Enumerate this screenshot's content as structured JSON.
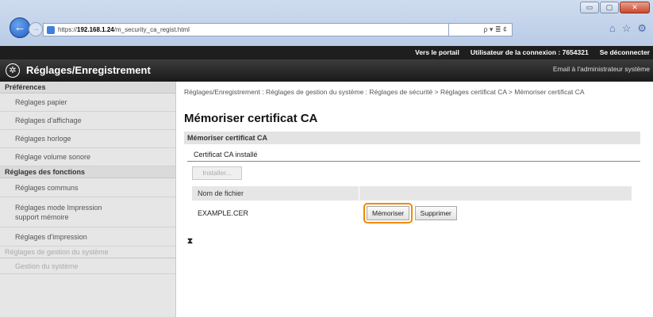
{
  "browser": {
    "url_prefix": "https://",
    "url_host": "192.168.1.24",
    "url_path": "/m_security_ca_regist.html",
    "addr_tools": "ρ ▾ ≣ ¢",
    "back_glyph": "←",
    "forward_glyph": "→",
    "window_controls": [
      "▭",
      "▢",
      "✕"
    ],
    "toolbar_icons": [
      "⌂",
      "☆",
      "⚙"
    ]
  },
  "topbar": {
    "portal_link": "Vers le portail",
    "login_user": "Utilisateur de la connexion :  7654321",
    "logout_link": "Se déconnecter"
  },
  "header": {
    "logo_glyph": "✲",
    "title": "Réglages/Enregistrement",
    "email_admin": "Email à l'administrateur système"
  },
  "sidebar": {
    "section_preferences": "Préférences",
    "preferences_items": [
      "Réglages papier",
      "Réglages d'affichage",
      "Réglages horloge",
      "Réglage volume sonore"
    ],
    "section_functions": "Réglages des fonctions",
    "functions_items": [
      "Réglages communs",
      "Réglages mode Impression support mémoire",
      "Réglages d'impression"
    ],
    "section_system": "Réglages de gestion du système",
    "system_items": [
      "Gestion du système"
    ]
  },
  "main": {
    "breadcrumb": "Réglages/Enregistrement : Réglages de gestion du système : Réglages de sécurité > Réglages certificat CA > Mémoriser certificat CA",
    "page_title": "Mémoriser certificat CA",
    "section_title": "Mémoriser certificat CA",
    "installed_heading": "Certificat CA installé",
    "install_button": "Installer...",
    "table": {
      "header_filename": "Nom de fichier",
      "rows": [
        {
          "filename": "EXAMPLE.CER",
          "store_button": "Mémoriser",
          "delete_button": "Supprimer"
        }
      ]
    },
    "top_link": "⧗"
  },
  "colors": {
    "highlight": "#f08a00",
    "header_bg": "#1e1e1e",
    "sidebar_bg": "#e6e6e6"
  }
}
